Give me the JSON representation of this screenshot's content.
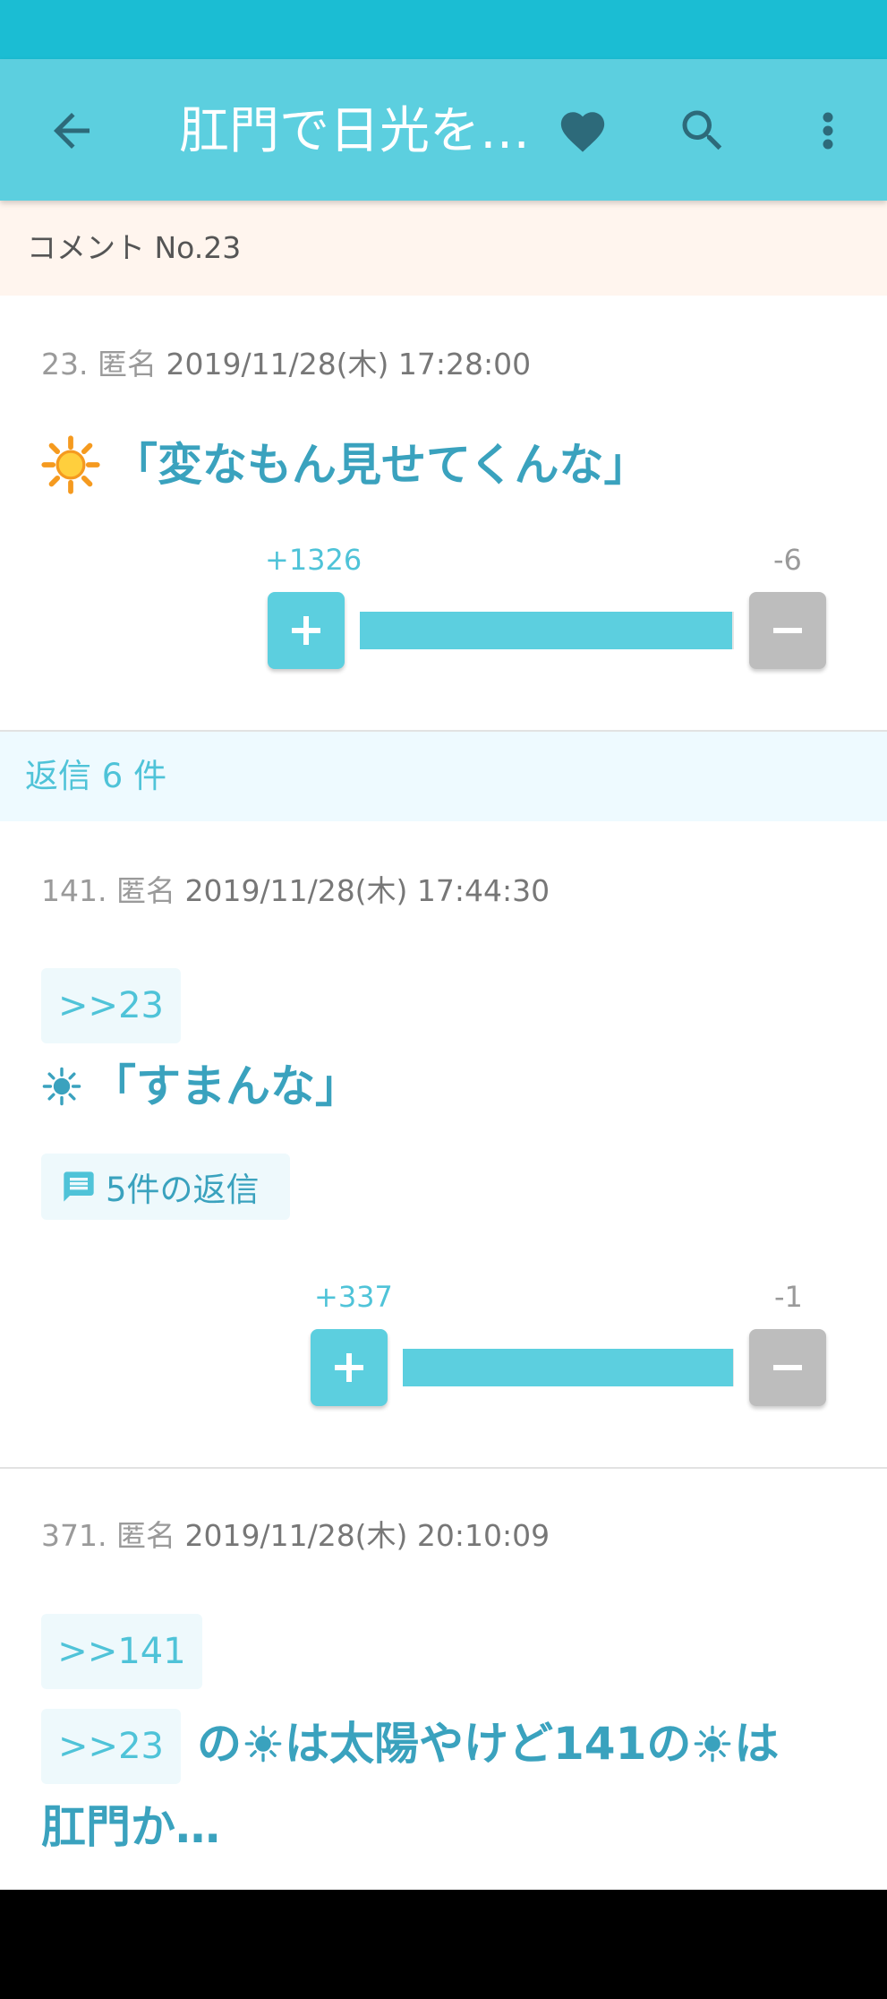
{
  "app_bar": {
    "title": "肛門で日光を…",
    "icons": [
      "arrow-back-icon",
      "heart-icon",
      "search-icon",
      "more-vert-icon"
    ]
  },
  "comment_header": "コメント No.23",
  "comments": [
    {
      "number": "23.",
      "author": "匿名",
      "date": "2019/11/28(木) 17:28:00",
      "text": "「変なもん見せてくんな」",
      "votes": {
        "plus": "+1326",
        "minus": "-6",
        "ratio": 0.995
      }
    },
    {
      "number": "141.",
      "author": "匿名",
      "date": "2019/11/28(木) 17:44:30",
      "ref": ">>23",
      "text": "「すまんな」",
      "replies_label": "5件の返信",
      "votes": {
        "plus": "+337",
        "minus": "-1",
        "ratio": 0.997
      }
    },
    {
      "number": "371.",
      "author": "匿名",
      "date": "2019/11/28(木) 20:10:09",
      "ref1": ">>141",
      "ref2": ">>23",
      "text_part1": "の",
      "text_part2": "は太陽やけど141の",
      "text_part3": "は",
      "text_line2": "肛門か…"
    }
  ],
  "replies_header": "返信 6 件",
  "colors": {
    "primary": "#5ccfdf",
    "status_bar": "#1bbdd3",
    "accent_text": "#3aa2be",
    "minus_button": "#bdbdbd"
  }
}
